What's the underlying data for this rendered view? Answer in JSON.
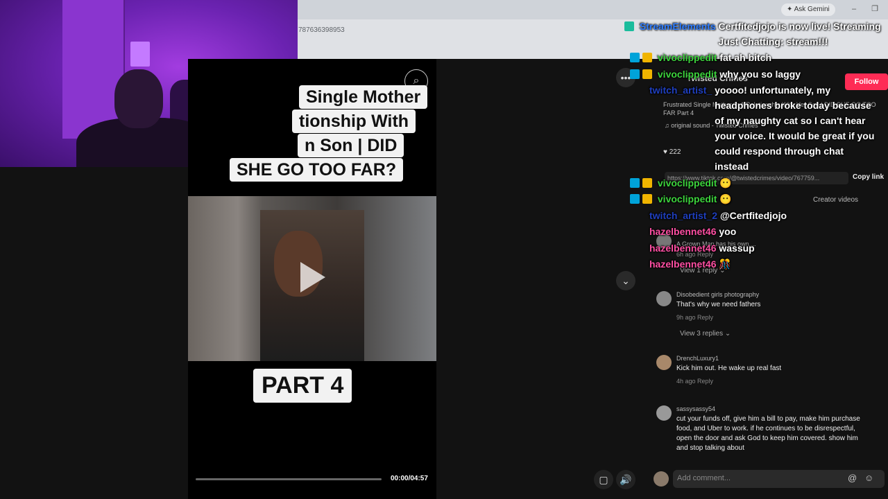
{
  "browser": {
    "ask_gemini": "Ask Gemini",
    "url_fragment": "787636398953"
  },
  "video": {
    "title_lines": [
      "Single Mother",
      "tionship With",
      "n Son | DID",
      "SHE GO TOO FAR?"
    ],
    "part_label": "PART 4",
    "time": "00:00/04:57"
  },
  "panel": {
    "creator": "Twisted Crimes",
    "follow": "Follow",
    "description": "Frustrated Single Mother In A Relationship With Her Son | DID SHE GO TOO FAR Part 4",
    "sound": "♫ original sound - Twisted Crimes",
    "likes": "222",
    "link": "https://www.tiktok.com/@twistedcrimes/video/767759...",
    "copy_link": "Copy link",
    "creator_videos": "Creator videos",
    "add_comment_placeholder": "Add comment..."
  },
  "comments": [
    {
      "text": "A Grown Man has his own....",
      "meta": "6h ago   Reply",
      "replies": "View 1 reply ⌄"
    },
    {
      "user": "Disobedient girls photography",
      "text": "That's why we need fathers",
      "meta": "9h ago   Reply",
      "replies": "View 3 replies ⌄"
    },
    {
      "user": "DrenchLuxury1",
      "text": "Kick him out. He wake up real fast",
      "meta": "4h ago   Reply"
    },
    {
      "user": "sassysassy54",
      "text": "cut your funds off, give him a bill to pay, make him purchase food, and Uber to work. if he continues to be disrespectful, open the door and ask God to keep him covered. show him and stop talking about"
    }
  ],
  "chat": [
    {
      "user": "StreamElements",
      "text": "Certfitedjojo is now live! Streaming Just Chatting: stream!!!"
    },
    {
      "user": "vivoclippedit",
      "text": "fat ah bitch"
    },
    {
      "user": "vivoclippedit",
      "text": "why you so laggy"
    },
    {
      "user": "twitch_artist_",
      "text": "yoooo! unfortunately, my headphones broke today because of my naughty cat so I can't hear your voice. It would be great if you could respond through chat instead"
    },
    {
      "user": "vivoclippedit"
    },
    {
      "user": "vivoclippedit"
    },
    {
      "user": "twitch_artist_2",
      "text": "@Certfitedjojo"
    },
    {
      "user": "hazelbennet46",
      "text": "yoo"
    },
    {
      "user": "hazelbennet46",
      "text": "wassup"
    },
    {
      "user": "hazelbennet46"
    }
  ]
}
